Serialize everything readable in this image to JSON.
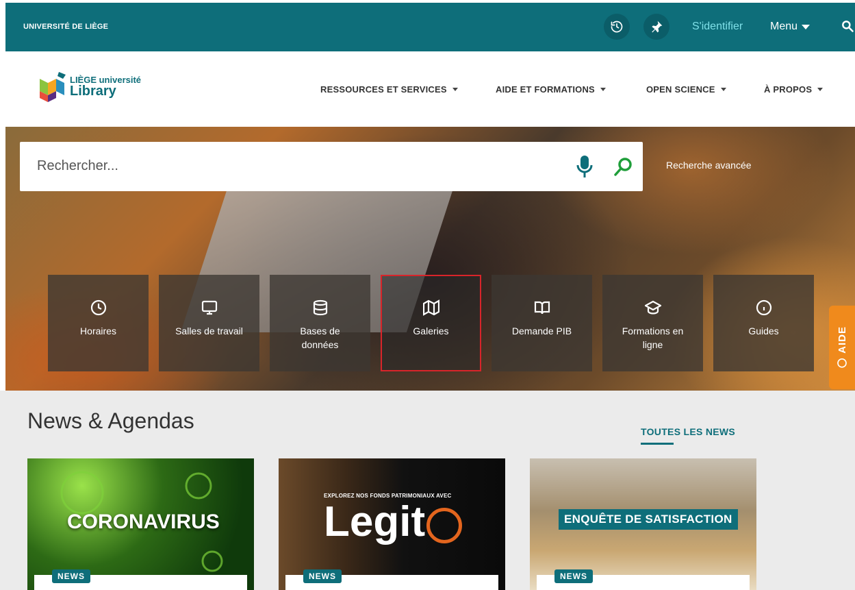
{
  "topbar": {
    "university": "UNIVERSITÉ DE LIÈGE",
    "history_icon": "history-icon",
    "pin_icon": "pin-icon",
    "login": "S'identifier",
    "menu": "Menu",
    "search_icon": "search-icon"
  },
  "logo": {
    "line1": "LIÈGE université",
    "line2": "Library"
  },
  "nav": {
    "items": [
      {
        "label": "RESSOURCES ET SERVICES"
      },
      {
        "label": "AIDE ET FORMATIONS"
      },
      {
        "label": "OPEN SCIENCE"
      },
      {
        "label": "À PROPOS"
      }
    ]
  },
  "search": {
    "placeholder": "Rechercher...",
    "advanced": "Recherche avancée"
  },
  "tiles": [
    {
      "label": "Horaires",
      "icon": "clock-icon"
    },
    {
      "label": "Salles de travail",
      "icon": "monitor-icon"
    },
    {
      "label": "Bases de données",
      "icon": "database-icon"
    },
    {
      "label": "Galeries",
      "icon": "map-icon"
    },
    {
      "label": "Demande PIB",
      "icon": "book-icon"
    },
    {
      "label": "Formations en ligne",
      "icon": "graduation-cap-icon"
    },
    {
      "label": "Guides",
      "icon": "info-icon"
    }
  ],
  "aide": {
    "label": "AIDE"
  },
  "news": {
    "title": "News & Agendas",
    "all": "TOUTES LES NEWS",
    "cards": [
      {
        "headline": "CORONAVIRUS",
        "badge": "NEWS"
      },
      {
        "subline": "EXPLOREZ NOS FONDS PATRIMONIAUX AVEC",
        "headline": "Legit",
        "badge": "NEWS"
      },
      {
        "headline": "ENQUÊTE DE SATISFACTION",
        "badge": "NEWS"
      }
    ]
  },
  "colors": {
    "brand": "#0e6e7a",
    "accent_orange": "#f08a1c",
    "highlight_red": "#d9242a"
  }
}
